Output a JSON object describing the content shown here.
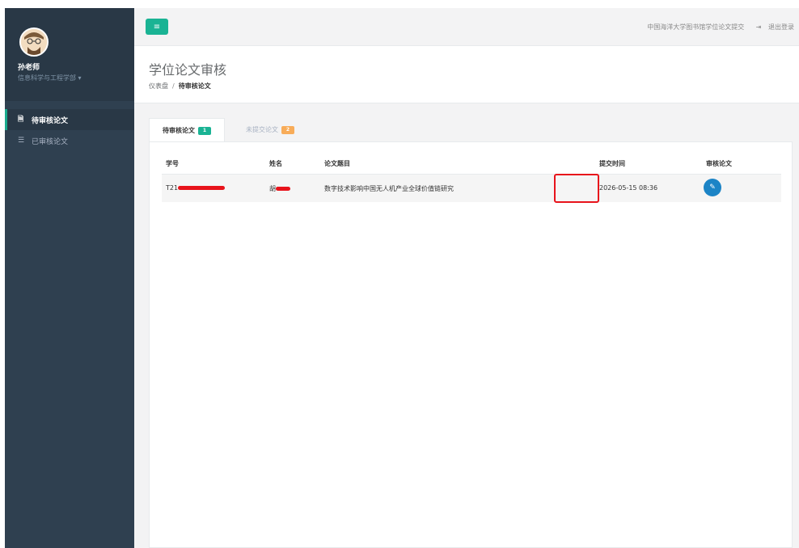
{
  "sidebar": {
    "user_name": "孙老师",
    "department": "信息科学与工程学部",
    "dept_caret": "▾",
    "items": [
      {
        "label": "待审核论文",
        "icon": "document-icon",
        "glyph": "🗎",
        "active": true
      },
      {
        "label": "已审核论文",
        "icon": "list-icon",
        "glyph": "☰",
        "active": false
      }
    ]
  },
  "topbar": {
    "menu_glyph": "≡",
    "system_name": "中国海洋大学图书馆学位论文提交",
    "logout_glyph": "⇥",
    "logout_label": "退出登录"
  },
  "heading": {
    "title": "学位论文审核",
    "breadcrumb": [
      "仪表盘",
      "待审核论文"
    ],
    "separator": "/"
  },
  "tabs": [
    {
      "label": "待审核论文",
      "count": "1",
      "badge_color": "#1ab394",
      "active": true
    },
    {
      "label": "未提交论文",
      "count": "2",
      "badge_color": "#f8ac59",
      "active": false
    }
  ],
  "table": {
    "columns": [
      "学号",
      "姓名",
      "论文题目",
      "提交时间",
      "审核论文"
    ],
    "rows": [
      {
        "student_id_prefix": "T21",
        "name_prefix": "胡",
        "title": "数字技术影响中国无人机产业全球价值链研究",
        "submitted": "2026-05-15 08:36",
        "action_icon": "edit-icon",
        "action_glyph": "✎"
      }
    ]
  },
  "colors": {
    "sidebar_bg": "#2f4050",
    "accent": "#1ab394",
    "action_blue": "#1c84c6",
    "highlight_red": "#e8131b"
  }
}
